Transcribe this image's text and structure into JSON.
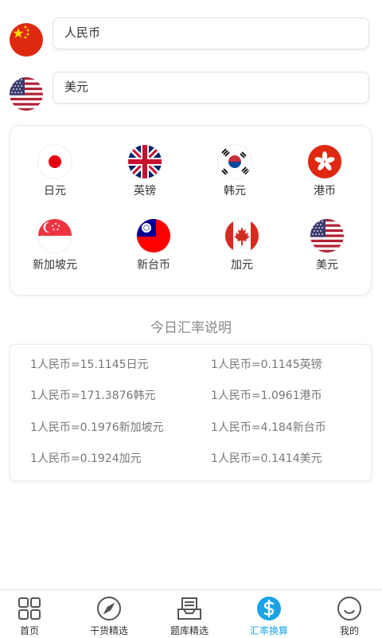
{
  "from": {
    "value": "人民币",
    "flag": "cn-flag-icon"
  },
  "to": {
    "value": "美元",
    "flag": "us-flag-icon"
  },
  "currencies": [
    {
      "label": "日元",
      "icon": "jp-flag-icon"
    },
    {
      "label": "英镑",
      "icon": "gb-flag-icon"
    },
    {
      "label": "韩元",
      "icon": "kr-flag-icon"
    },
    {
      "label": "港币",
      "icon": "hk-flag-icon"
    },
    {
      "label": "新加坡元",
      "icon": "sg-flag-icon"
    },
    {
      "label": "新台币",
      "icon": "tw-flag-icon"
    },
    {
      "label": "加元",
      "icon": "ca-flag-icon"
    },
    {
      "label": "美元",
      "icon": "us-flag-icon"
    }
  ],
  "rates_title": "今日汇率说明",
  "rates": [
    "1人民币=15.1145日元",
    "1人民币=0.1145英镑",
    "1人民币=171.3876韩元",
    "1人民币=1.0961港币",
    "1人民币=0.1976新加坡元",
    "1人民币=4.184新台币",
    "1人民币=0.1924加元",
    "1人民币=0.1414美元"
  ],
  "tabs": [
    {
      "label": "首页",
      "icon": "grid-icon",
      "active": false
    },
    {
      "label": "干货精选",
      "icon": "compass-icon",
      "active": false
    },
    {
      "label": "题库精选",
      "icon": "inbox-icon",
      "active": false
    },
    {
      "label": "汇率换算",
      "icon": "dollar-icon",
      "active": true
    },
    {
      "label": "我的",
      "icon": "smile-icon",
      "active": false
    }
  ],
  "colors": {
    "accent": "#1aa3e8",
    "text": "#333333",
    "muted": "#888888"
  }
}
